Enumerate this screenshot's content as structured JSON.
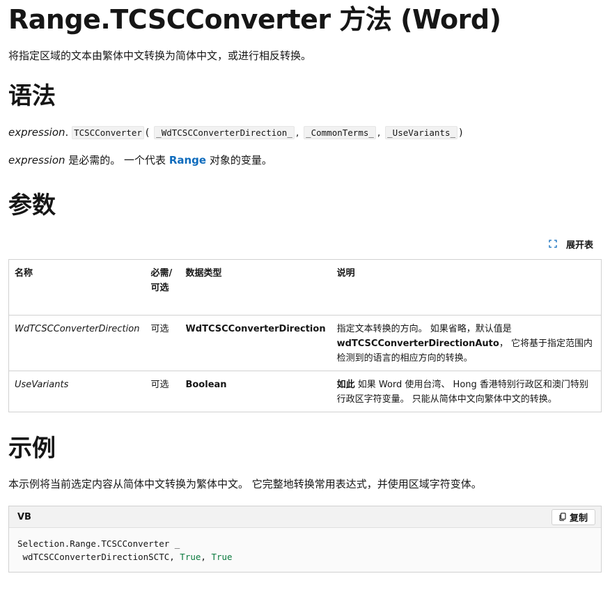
{
  "page": {
    "title": "Range.TCSCConverter 方法 (Word)",
    "summary": "将指定区域的文本由繁体中文转换为简体中文，或进行相反转换。"
  },
  "syntax": {
    "heading": "语法",
    "expression_prefix": "expression",
    "dot": ".",
    "method": "TCSCConverter",
    "open_paren": "(",
    "params": [
      "_WdTCSCConverterDirection_",
      "_CommonTerms_",
      "_UseVariants_"
    ],
    "separator": ",",
    "close_paren": ")",
    "expr_word": "expression",
    "expr_text_before": " 是必需的。 一个代表 ",
    "expr_link": "Range",
    "expr_text_after": " 对象的变量。"
  },
  "parameters": {
    "heading": "参数",
    "expand_label": "展开表",
    "columns": [
      "名称",
      "必需/可选",
      "数据类型",
      "说明"
    ],
    "rows": [
      {
        "name": "WdTCSCConverterDirection",
        "required": "可选",
        "type": "WdTCSCConverterDirection",
        "desc_before": "指定文本转换的方向。 如果省略，默认值是 ",
        "desc_bold": "wdTCSCConverterDirectionAuto",
        "desc_after": "， 它将基于指定范围内检测到的语言的相应方向的转换。"
      },
      {
        "name": "UseVariants",
        "required": "可选",
        "type": "Boolean",
        "desc_bold": "如此",
        "desc_after": " 如果 Word 使用台湾、 Hong 香港特别行政区和澳门特别行政区字符变量。 只能从简体中文向繁体中文的转换。"
      }
    ]
  },
  "example": {
    "heading": "示例",
    "description": "本示例将当前选定内容从简体中文转换为繁体中文。 它完整地转换常用表达式，并使用区域字符变体。",
    "language": "VB",
    "copy_label": "复制",
    "code_line1": "Selection.Range.TCSCConverter _",
    "code_line2_prefix": " wdTCSCConverterDirectionSCTC, ",
    "code_kw1": "True",
    "code_sep": ", ",
    "code_kw2": "True"
  },
  "colors": {
    "link": "#0f6cbd",
    "keyword": "#0b7a3e",
    "border": "#d1d1d1"
  },
  "icons": {
    "expand": "expand-icon",
    "copy": "copy-icon"
  }
}
